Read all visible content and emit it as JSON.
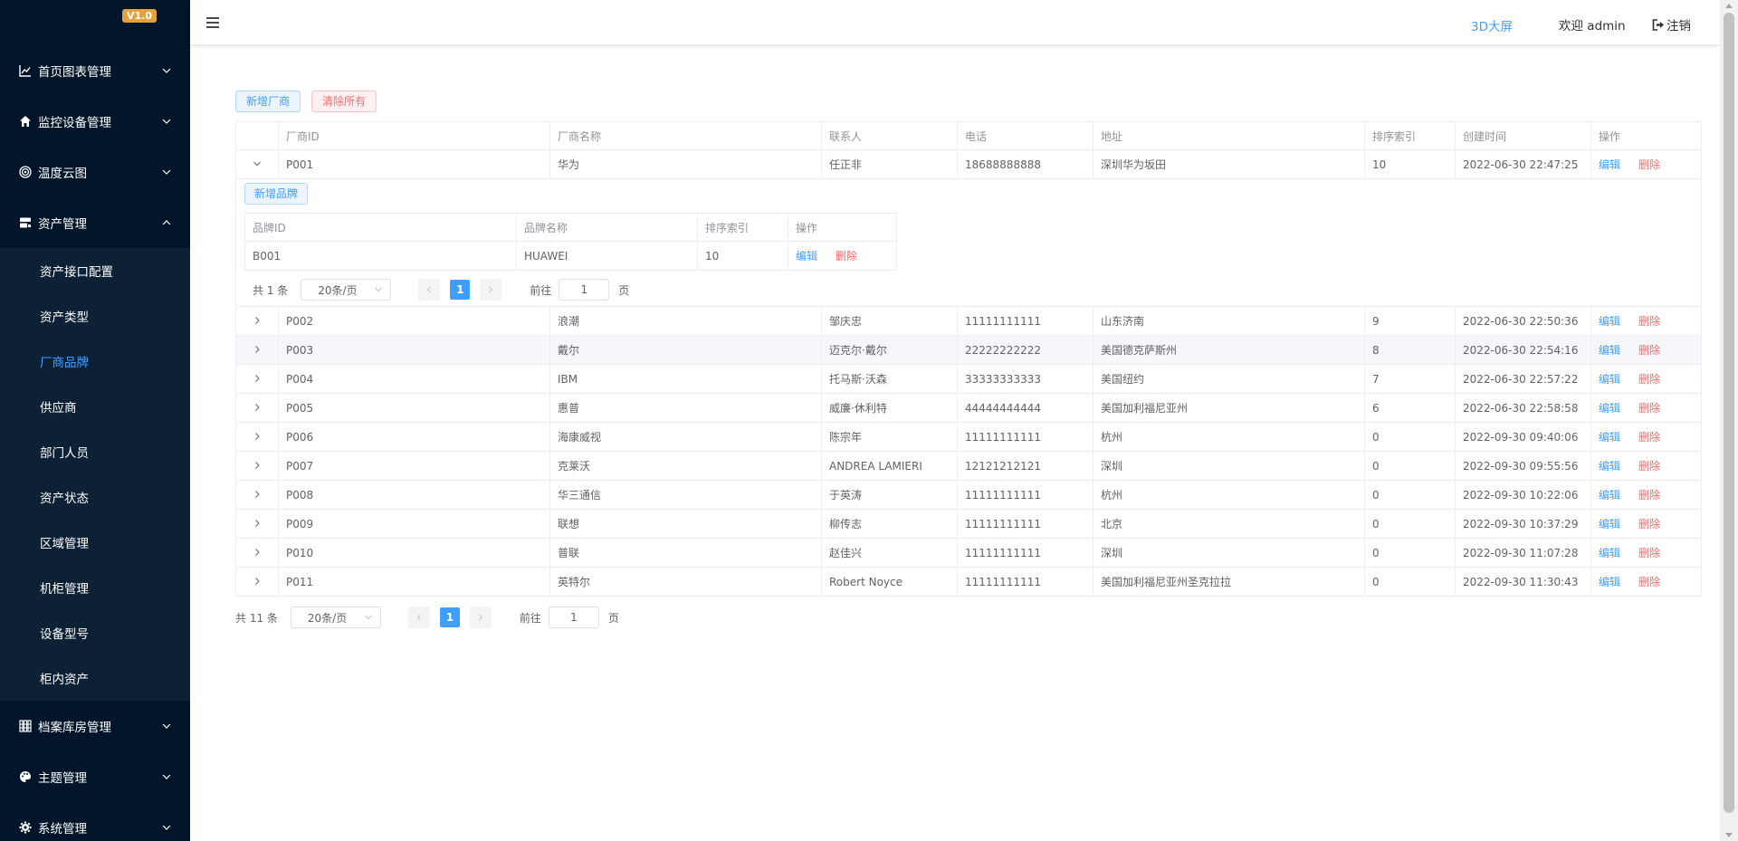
{
  "app": {
    "version": "V1.0"
  },
  "header": {
    "link_3d": "3D大屏",
    "welcome": "欢迎 admin",
    "logout": "注销"
  },
  "sidebar": {
    "menus": [
      {
        "label": "首页图表管理",
        "icon": "line-chart-icon"
      },
      {
        "label": "监控设备管理",
        "icon": "home-icon"
      },
      {
        "label": "温度云图",
        "icon": "target-icon"
      },
      {
        "label": "资产管理",
        "icon": "server-icon",
        "expanded": true
      }
    ],
    "asset_submenu": [
      "资产接口配置",
      "资产类型",
      "厂商品牌",
      "供应商",
      "部门人员",
      "资产状态",
      "区域管理",
      "机柜管理",
      "设备型号",
      "柜内资产"
    ],
    "bottom_menus": [
      {
        "label": "档案库房管理",
        "icon": "grid-icon"
      },
      {
        "label": "主题管理",
        "icon": "palette-icon"
      },
      {
        "label": "系统管理",
        "icon": "gear-icon"
      }
    ]
  },
  "toolbar": {
    "add_vendor": "新增厂商",
    "clear_all": "清除所有"
  },
  "table": {
    "columns": [
      "厂商ID",
      "厂商名称",
      "联系人",
      "电话",
      "地址",
      "排序索引",
      "创建时间",
      "操作"
    ],
    "edit_label": "编辑",
    "delete_label": "删除",
    "rows": [
      {
        "id": "P001",
        "name": "华为",
        "contact": "任正非",
        "phone": "18688888888",
        "address": "深圳华为坂田",
        "sort": "10",
        "created": "2022-06-30 22:47:25"
      },
      {
        "id": "P002",
        "name": "浪潮",
        "contact": "邹庆忠",
        "phone": "11111111111",
        "address": "山东济南",
        "sort": "9",
        "created": "2022-06-30 22:50:36"
      },
      {
        "id": "P003",
        "name": "戴尔",
        "contact": "迈克尔·戴尔",
        "phone": "22222222222",
        "address": "美国德克萨斯州",
        "sort": "8",
        "created": "2022-06-30 22:54:16"
      },
      {
        "id": "P004",
        "name": "IBM",
        "contact": "托马斯·沃森",
        "phone": "33333333333",
        "address": "美国纽约",
        "sort": "7",
        "created": "2022-06-30 22:57:22"
      },
      {
        "id": "P005",
        "name": "惠普",
        "contact": "威廉·休利特",
        "phone": "44444444444",
        "address": "美国加利福尼亚州",
        "sort": "6",
        "created": "2022-06-30 22:58:58"
      },
      {
        "id": "P006",
        "name": "海康威视",
        "contact": "陈宗年",
        "phone": "11111111111",
        "address": "杭州",
        "sort": "0",
        "created": "2022-09-30 09:40:06"
      },
      {
        "id": "P007",
        "name": "克莱沃",
        "contact": "ANDREA LAMIERI",
        "phone": "12121212121",
        "address": "深圳",
        "sort": "0",
        "created": "2022-09-30 09:55:56"
      },
      {
        "id": "P008",
        "name": "华三通信",
        "contact": "于英涛",
        "phone": "11111111111",
        "address": "杭州",
        "sort": "0",
        "created": "2022-09-30 10:22:06"
      },
      {
        "id": "P009",
        "name": "联想",
        "contact": "柳传志",
        "phone": "11111111111",
        "address": "北京",
        "sort": "0",
        "created": "2022-09-30 10:37:29"
      },
      {
        "id": "P010",
        "name": "普联",
        "contact": "赵佳兴",
        "phone": "11111111111",
        "address": "深圳",
        "sort": "0",
        "created": "2022-09-30 11:07:28"
      },
      {
        "id": "P011",
        "name": "英特尔",
        "contact": "Robert Noyce",
        "phone": "11111111111",
        "address": "美国加利福尼亚州圣克拉拉",
        "sort": "0",
        "created": "2022-09-30 11:30:43"
      }
    ]
  },
  "brand": {
    "add_label": "新增品牌",
    "columns": [
      "品牌ID",
      "品牌名称",
      "排序索引",
      "操作"
    ],
    "rows": [
      {
        "id": "B001",
        "name": "HUAWEI",
        "sort": "10"
      }
    ],
    "pagination": {
      "total": "共 1 条",
      "page_size": "20条/页",
      "current": "1",
      "goto": "前往",
      "goto_value": "1",
      "page_unit": "页"
    }
  },
  "pagination": {
    "total": "共 11 条",
    "page_size": "20条/页",
    "current": "1",
    "goto": "前往",
    "goto_value": "1",
    "page_unit": "页"
  },
  "colors": {
    "sidebar_bg": "#001529",
    "submenu_bg": "#0c2135",
    "primary": "#409eff",
    "danger": "#f56c6c",
    "badge": "#e6a23c"
  }
}
